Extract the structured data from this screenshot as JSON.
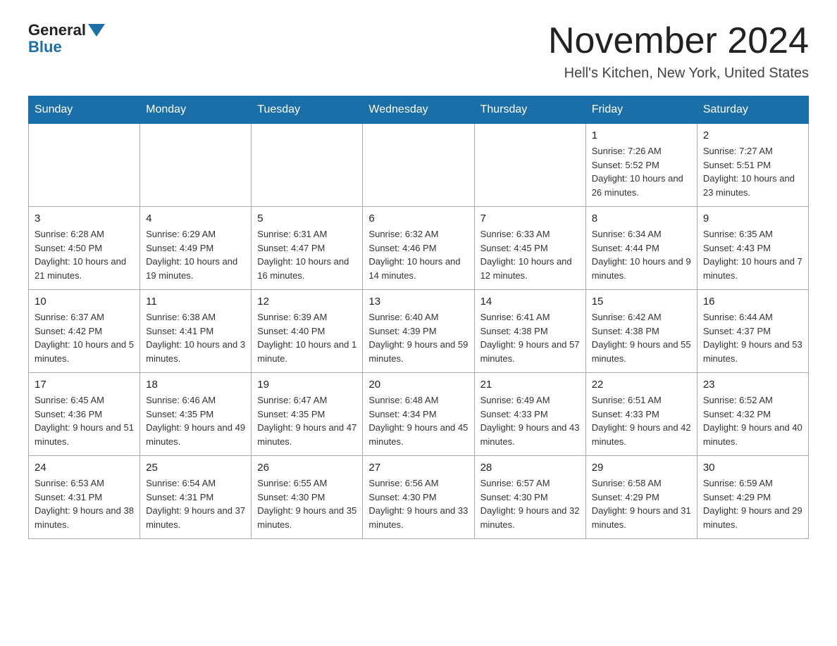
{
  "logo": {
    "text_general": "General",
    "text_blue": "Blue"
  },
  "header": {
    "month_title": "November 2024",
    "location": "Hell's Kitchen, New York, United States"
  },
  "weekdays": [
    "Sunday",
    "Monday",
    "Tuesday",
    "Wednesday",
    "Thursday",
    "Friday",
    "Saturday"
  ],
  "weeks": [
    [
      {
        "day": "",
        "info": ""
      },
      {
        "day": "",
        "info": ""
      },
      {
        "day": "",
        "info": ""
      },
      {
        "day": "",
        "info": ""
      },
      {
        "day": "",
        "info": ""
      },
      {
        "day": "1",
        "info": "Sunrise: 7:26 AM\nSunset: 5:52 PM\nDaylight: 10 hours and 26 minutes."
      },
      {
        "day": "2",
        "info": "Sunrise: 7:27 AM\nSunset: 5:51 PM\nDaylight: 10 hours and 23 minutes."
      }
    ],
    [
      {
        "day": "3",
        "info": "Sunrise: 6:28 AM\nSunset: 4:50 PM\nDaylight: 10 hours and 21 minutes."
      },
      {
        "day": "4",
        "info": "Sunrise: 6:29 AM\nSunset: 4:49 PM\nDaylight: 10 hours and 19 minutes."
      },
      {
        "day": "5",
        "info": "Sunrise: 6:31 AM\nSunset: 4:47 PM\nDaylight: 10 hours and 16 minutes."
      },
      {
        "day": "6",
        "info": "Sunrise: 6:32 AM\nSunset: 4:46 PM\nDaylight: 10 hours and 14 minutes."
      },
      {
        "day": "7",
        "info": "Sunrise: 6:33 AM\nSunset: 4:45 PM\nDaylight: 10 hours and 12 minutes."
      },
      {
        "day": "8",
        "info": "Sunrise: 6:34 AM\nSunset: 4:44 PM\nDaylight: 10 hours and 9 minutes."
      },
      {
        "day": "9",
        "info": "Sunrise: 6:35 AM\nSunset: 4:43 PM\nDaylight: 10 hours and 7 minutes."
      }
    ],
    [
      {
        "day": "10",
        "info": "Sunrise: 6:37 AM\nSunset: 4:42 PM\nDaylight: 10 hours and 5 minutes."
      },
      {
        "day": "11",
        "info": "Sunrise: 6:38 AM\nSunset: 4:41 PM\nDaylight: 10 hours and 3 minutes."
      },
      {
        "day": "12",
        "info": "Sunrise: 6:39 AM\nSunset: 4:40 PM\nDaylight: 10 hours and 1 minute."
      },
      {
        "day": "13",
        "info": "Sunrise: 6:40 AM\nSunset: 4:39 PM\nDaylight: 9 hours and 59 minutes."
      },
      {
        "day": "14",
        "info": "Sunrise: 6:41 AM\nSunset: 4:38 PM\nDaylight: 9 hours and 57 minutes."
      },
      {
        "day": "15",
        "info": "Sunrise: 6:42 AM\nSunset: 4:38 PM\nDaylight: 9 hours and 55 minutes."
      },
      {
        "day": "16",
        "info": "Sunrise: 6:44 AM\nSunset: 4:37 PM\nDaylight: 9 hours and 53 minutes."
      }
    ],
    [
      {
        "day": "17",
        "info": "Sunrise: 6:45 AM\nSunset: 4:36 PM\nDaylight: 9 hours and 51 minutes."
      },
      {
        "day": "18",
        "info": "Sunrise: 6:46 AM\nSunset: 4:35 PM\nDaylight: 9 hours and 49 minutes."
      },
      {
        "day": "19",
        "info": "Sunrise: 6:47 AM\nSunset: 4:35 PM\nDaylight: 9 hours and 47 minutes."
      },
      {
        "day": "20",
        "info": "Sunrise: 6:48 AM\nSunset: 4:34 PM\nDaylight: 9 hours and 45 minutes."
      },
      {
        "day": "21",
        "info": "Sunrise: 6:49 AM\nSunset: 4:33 PM\nDaylight: 9 hours and 43 minutes."
      },
      {
        "day": "22",
        "info": "Sunrise: 6:51 AM\nSunset: 4:33 PM\nDaylight: 9 hours and 42 minutes."
      },
      {
        "day": "23",
        "info": "Sunrise: 6:52 AM\nSunset: 4:32 PM\nDaylight: 9 hours and 40 minutes."
      }
    ],
    [
      {
        "day": "24",
        "info": "Sunrise: 6:53 AM\nSunset: 4:31 PM\nDaylight: 9 hours and 38 minutes."
      },
      {
        "day": "25",
        "info": "Sunrise: 6:54 AM\nSunset: 4:31 PM\nDaylight: 9 hours and 37 minutes."
      },
      {
        "day": "26",
        "info": "Sunrise: 6:55 AM\nSunset: 4:30 PM\nDaylight: 9 hours and 35 minutes."
      },
      {
        "day": "27",
        "info": "Sunrise: 6:56 AM\nSunset: 4:30 PM\nDaylight: 9 hours and 33 minutes."
      },
      {
        "day": "28",
        "info": "Sunrise: 6:57 AM\nSunset: 4:30 PM\nDaylight: 9 hours and 32 minutes."
      },
      {
        "day": "29",
        "info": "Sunrise: 6:58 AM\nSunset: 4:29 PM\nDaylight: 9 hours and 31 minutes."
      },
      {
        "day": "30",
        "info": "Sunrise: 6:59 AM\nSunset: 4:29 PM\nDaylight: 9 hours and 29 minutes."
      }
    ]
  ]
}
